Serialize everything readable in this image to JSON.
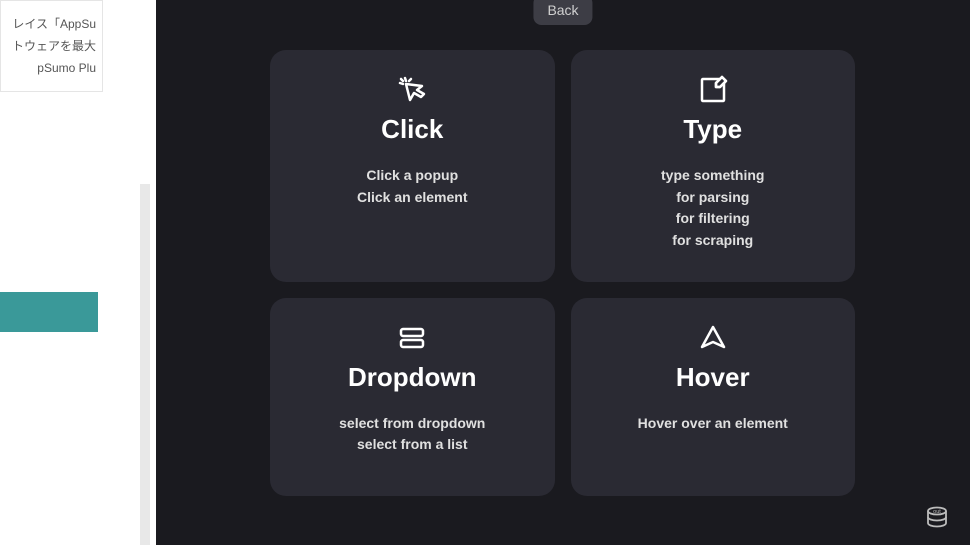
{
  "sidebar": {
    "text_lines": [
      "レイス「AppSu",
      "トウェアを最大",
      "pSumo Plu"
    ]
  },
  "panel": {
    "back_label": "Back",
    "cards": [
      {
        "icon": "cursor-click-icon",
        "title": "Click",
        "lines": [
          "Click a popup",
          "Click an element"
        ]
      },
      {
        "icon": "edit-icon",
        "title": "Type",
        "lines": [
          "type something",
          "for parsing",
          "for filtering",
          "for scraping"
        ]
      },
      {
        "icon": "dropdown-icon",
        "title": "Dropdown",
        "lines": [
          "select from dropdown",
          "select from a list"
        ]
      },
      {
        "icon": "navigate-icon",
        "title": "Hover",
        "lines": [
          "Hover over an element"
        ]
      }
    ],
    "corner_badge": "out"
  }
}
